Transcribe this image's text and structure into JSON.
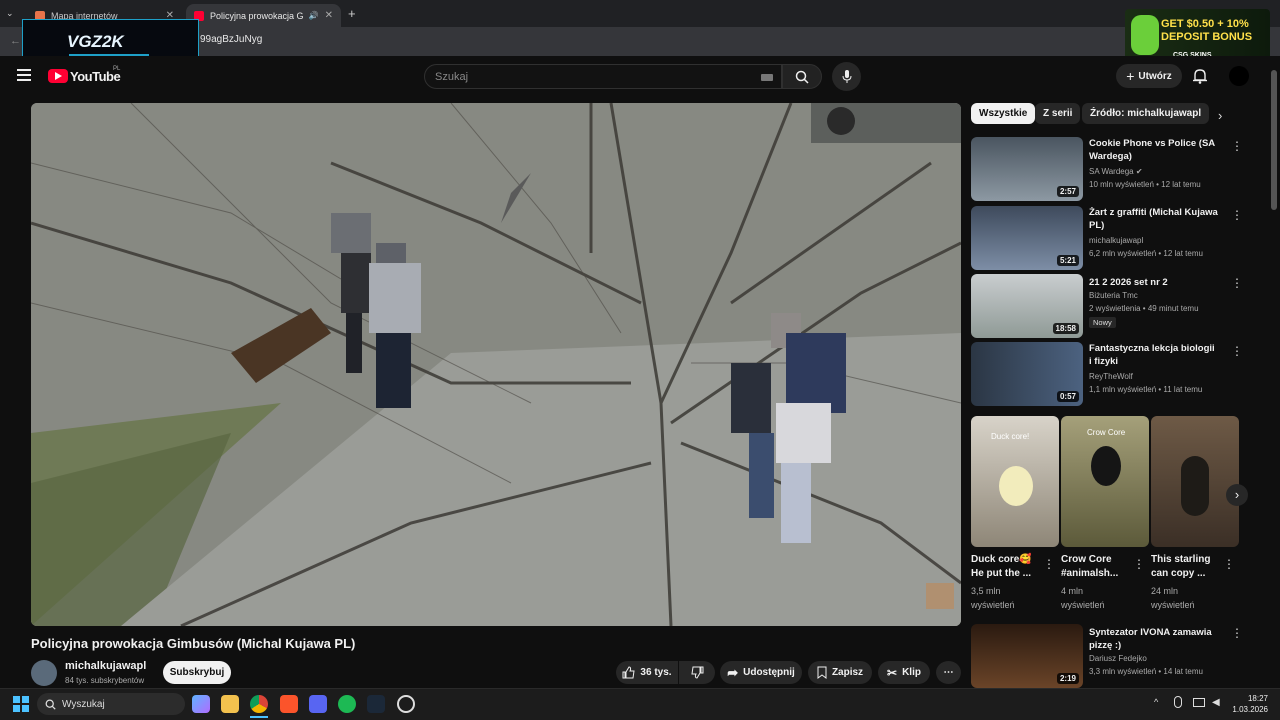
{
  "browser": {
    "tabs": [
      {
        "label": "Mapa internetów"
      },
      {
        "label": "Policyjna prowokacja Gimbu"
      }
    ],
    "url_partial": "99agBzJuNyg"
  },
  "overlay": {
    "streamer_logo": "VGZ2K",
    "ad_line1": "GET $0.50 + 10%",
    "ad_line2": "DEPOSIT BONUS",
    "ad_brand": "CSG SKINS"
  },
  "header": {
    "logo": "YouTube",
    "logo_region": "PL",
    "search_placeholder": "Szukaj",
    "create_label": "Utwórz"
  },
  "video": {
    "title": "Policyjna prowokacja Gimbusów (Michal Kujawa PL)",
    "channel": "michalkujawapl",
    "subscribers": "84 tys. subskrybentów",
    "subscribe_label": "Subskrybuj",
    "likes": "36 tys.",
    "share_label": "Udostępnij",
    "save_label": "Zapisz",
    "clip_label": "Klip"
  },
  "filters": {
    "chips": [
      "Wszystkie",
      "Z serii",
      "Źródło: michalkujawapl"
    ]
  },
  "recommendations": [
    {
      "title": "Cookie Phone vs Police (SA Wardega)",
      "channel": "SA Wardega",
      "meta": "10 mln wyświetleń • 12 lat temu",
      "duration": "2:57",
      "thumb_color": "#6f7d88"
    },
    {
      "title": "Żart z graffiti (Michal Kujawa PL)",
      "channel": "michalkujawapl",
      "meta": "6,2 mln wyświetleń • 12 lat temu",
      "duration": "5:21",
      "thumb_color": "#56687e"
    },
    {
      "title": "21 2 2026 set nr 2",
      "channel": "Biżuteria Tmc",
      "meta": "2 wyświetlenia • 49 minut temu",
      "badge": "Nowy",
      "duration": "18:58",
      "thumb_color": "#9ea6a8"
    },
    {
      "title": "Fantastyczna lekcja biologii i fizyki",
      "channel": "ReyTheWolf",
      "meta": "1,1 mln wyświetleń • 11 lat temu",
      "duration": "0:57",
      "thumb_color": "#3a4a5e"
    }
  ],
  "shorts": [
    {
      "title": "Duck core🥰 He put the ...",
      "views1": "3,5 mln",
      "views2": "wyświetleń",
      "thumb_color": "#c9c2b5",
      "overlay": "Duck core!"
    },
    {
      "title": "Crow Core #animalsh...",
      "views1": "4 mln",
      "views2": "wyświetleń",
      "thumb_color": "#8a8a5a",
      "overlay": "Crow Core"
    },
    {
      "title": "This starling can copy ...",
      "views1": "24 mln",
      "views2": "wyświetleń",
      "thumb_color": "#6b5a4a",
      "overlay": ""
    }
  ],
  "recommendation_bottom": {
    "title": "Syntezator IVONA zamawia pizzę :)",
    "channel": "Dariusz Fedejko",
    "meta": "3,3 mln wyświetleń • 14 lat temu",
    "duration": "2:19",
    "thumb_color": "#4a2e1c"
  },
  "taskbar": {
    "search_placeholder": "Wyszukaj",
    "time": "18:27",
    "date": "1.03.2026"
  }
}
